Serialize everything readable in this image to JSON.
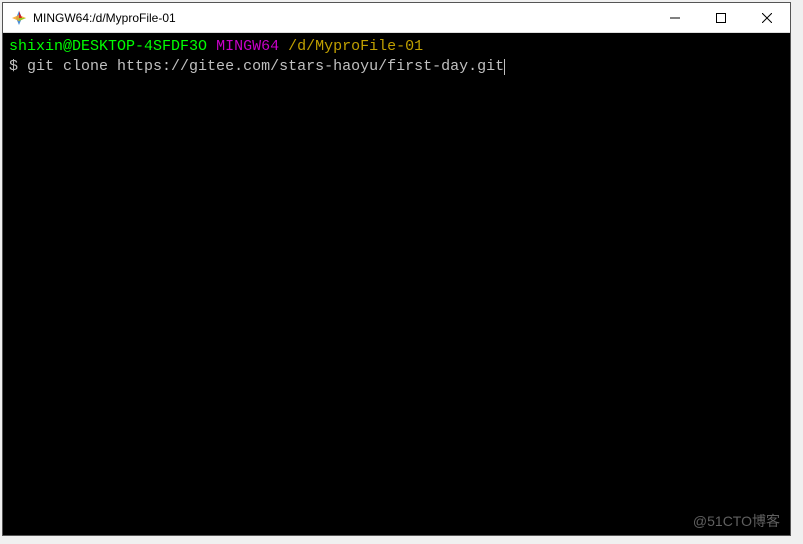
{
  "window": {
    "title": "MINGW64:/d/MyproFile-01"
  },
  "prompt": {
    "user_host": "shixin@DESKTOP-4SFDF3O",
    "env": "MINGW64",
    "path": "/d/MyproFile-01"
  },
  "command": {
    "symbol": "$",
    "text": "git clone https://gitee.com/stars-haoyu/first-day.git"
  },
  "watermark": "@51CTO博客"
}
